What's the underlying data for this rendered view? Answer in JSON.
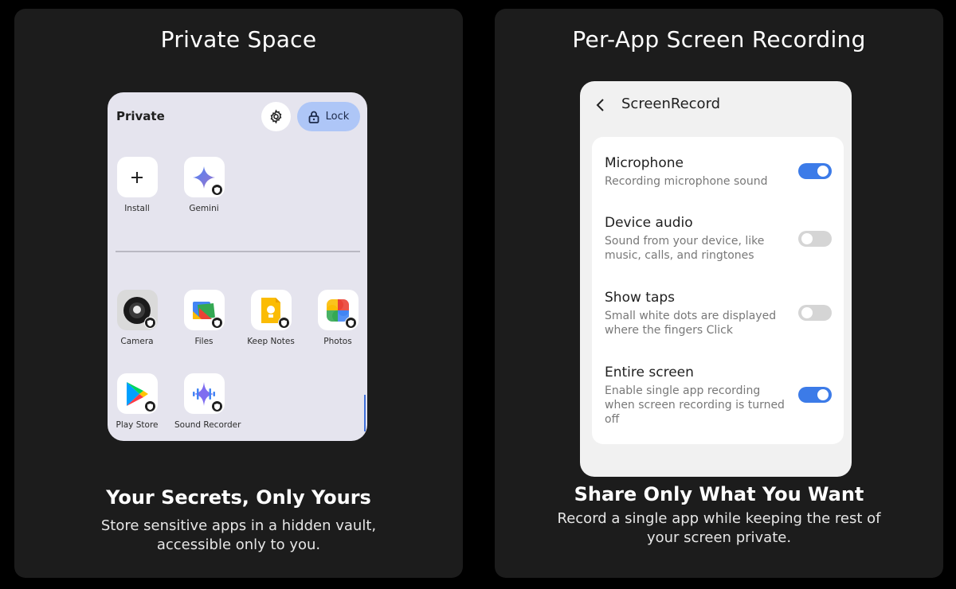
{
  "left_panel": {
    "title": "Private Space",
    "tagline": "Your Secrets, Only Yours",
    "description": "Store sensitive apps in a hidden vault, accessible only to you.",
    "phone": {
      "header_title": "Private",
      "settings_icon": "gear-icon",
      "lock_button_label": "Lock",
      "lock_icon": "lock-icon",
      "apps_top": [
        {
          "label": "Install",
          "icon": "plus-icon"
        },
        {
          "label": "Gemini",
          "icon": "gemini-icon"
        }
      ],
      "apps_bottom": [
        {
          "label": "Camera",
          "icon": "camera-icon"
        },
        {
          "label": "Files",
          "icon": "files-icon"
        },
        {
          "label": "Keep Notes",
          "icon": "keep-notes-icon"
        },
        {
          "label": "Photos",
          "icon": "photos-icon"
        },
        {
          "label": "Play Store",
          "icon": "play-store-icon"
        },
        {
          "label": "Sound Recorder",
          "icon": "sound-recorder-icon"
        }
      ]
    }
  },
  "right_panel": {
    "title": "Per-App Screen Recording",
    "tagline": "Share Only What You Want",
    "description": "Record a single app while keeping the rest of your screen private.",
    "phone": {
      "header_title": "ScreenRecord",
      "back_icon": "chevron-left-icon",
      "settings": [
        {
          "title": "Microphone",
          "description": "Recording microphone sound",
          "enabled": true
        },
        {
          "title": "Device audio",
          "description": "Sound from your device, like music, calls, and ringtones",
          "enabled": false
        },
        {
          "title": "Show taps",
          "description": "Small white dots are displayed where the fingers Click",
          "enabled": false
        },
        {
          "title": "Entire screen",
          "description": "Enable single app recording when screen recording is turned off",
          "enabled": true
        }
      ]
    }
  },
  "colors": {
    "page_background": "#000000",
    "panel_background": "#1c1c1c",
    "private_phone_background": "#e5e4ee",
    "lock_button": "#aec6f7",
    "toggle_on": "#3c7be8",
    "toggle_off": "#d5d5d5"
  }
}
